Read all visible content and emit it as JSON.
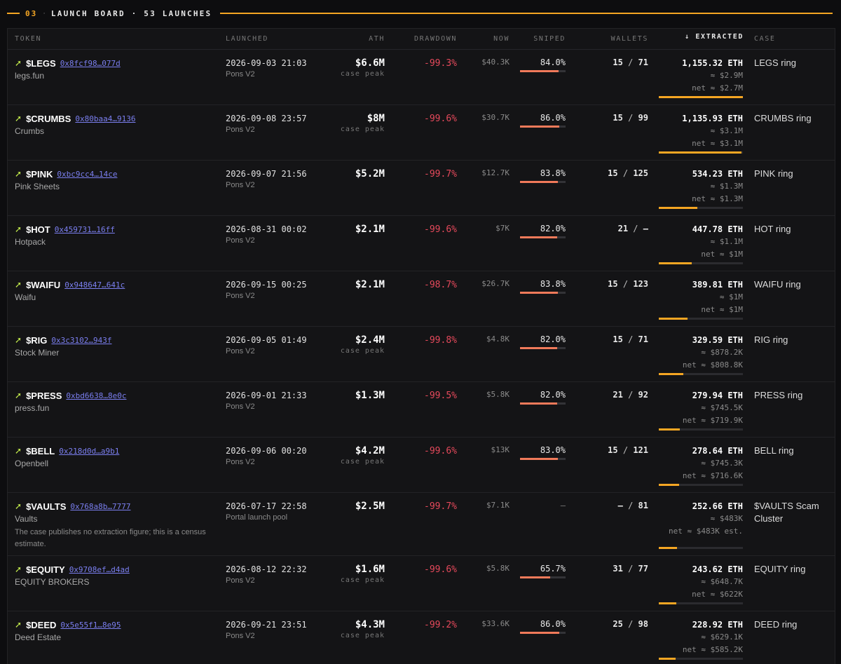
{
  "header": {
    "section_num": "03",
    "title": "LAUNCH BOARD · 53 LAUNCHES",
    "accent": "#f5a623"
  },
  "columns": {
    "token": "TOKEN",
    "launched": "LAUNCHED",
    "ath": "ATH",
    "drawdown": "DRAWDOWN",
    "now": "NOW",
    "sniped": "SNIPED",
    "wallets": "WALLETS",
    "extracted": "↓ EXTRACTED",
    "case": "CASE"
  },
  "rows": [
    {
      "symbol": "$LEGS",
      "addr": "0x8fcf98…077d",
      "name": "legs.fun",
      "launched": "2026-09-03 21:03",
      "platform": "Pons V2",
      "ath": "$6.6M",
      "ath_sub": "case peak",
      "drawdown": "-99.3%",
      "now": "$40.3K",
      "sniped": "84.0%",
      "sniped_frac": 0.84,
      "wallets_a": "15",
      "wallets_b": "71",
      "eth": "1,155.32 ETH",
      "usd": "≈ $2.9M",
      "net": "net ≈ $2.7M",
      "extract_frac": 1.0,
      "case": "LEGS ring"
    },
    {
      "symbol": "$CRUMBS",
      "addr": "0x80baa4…9136",
      "name": "Crumbs",
      "launched": "2026-09-08 23:57",
      "platform": "Pons V2",
      "ath": "$8M",
      "ath_sub": "case peak",
      "drawdown": "-99.6%",
      "now": "$30.7K",
      "sniped": "86.0%",
      "sniped_frac": 0.86,
      "wallets_a": "15",
      "wallets_b": "99",
      "eth": "1,135.93 ETH",
      "usd": "≈ $3.1M",
      "net": "net ≈ $3.1M",
      "extract_frac": 0.98,
      "case": "CRUMBS ring"
    },
    {
      "symbol": "$PINK",
      "addr": "0xbc9cc4…14ce",
      "name": "Pink Sheets",
      "launched": "2026-09-07 21:56",
      "platform": "Pons V2",
      "ath": "$5.2M",
      "ath_sub": "",
      "drawdown": "-99.7%",
      "now": "$12.7K",
      "sniped": "83.8%",
      "sniped_frac": 0.838,
      "wallets_a": "15",
      "wallets_b": "125",
      "eth": "534.23 ETH",
      "usd": "≈ $1.3M",
      "net": "net ≈ $1.3M",
      "extract_frac": 0.46,
      "case": "PINK ring"
    },
    {
      "symbol": "$HOT",
      "addr": "0x459731…16ff",
      "name": "Hotpack",
      "launched": "2026-08-31 00:02",
      "platform": "Pons V2",
      "ath": "$2.1M",
      "ath_sub": "",
      "drawdown": "-99.6%",
      "now": "$7K",
      "sniped": "82.0%",
      "sniped_frac": 0.82,
      "wallets_a": "21",
      "wallets_b": "—",
      "eth": "447.78 ETH",
      "usd": "≈ $1.1M",
      "net": "net ≈ $1M",
      "extract_frac": 0.39,
      "case": "HOT ring"
    },
    {
      "symbol": "$WAIFU",
      "addr": "0x948647…641c",
      "name": "Waifu",
      "launched": "2026-09-15 00:25",
      "platform": "Pons V2",
      "ath": "$2.1M",
      "ath_sub": "",
      "drawdown": "-98.7%",
      "now": "$26.7K",
      "sniped": "83.8%",
      "sniped_frac": 0.838,
      "wallets_a": "15",
      "wallets_b": "123",
      "eth": "389.81 ETH",
      "usd": "≈ $1M",
      "net": "net ≈ $1M",
      "extract_frac": 0.34,
      "case": "WAIFU ring"
    },
    {
      "symbol": "$RIG",
      "addr": "0x3c3102…943f",
      "name": "Stock Miner",
      "launched": "2026-09-05 01:49",
      "platform": "Pons V2",
      "ath": "$2.4M",
      "ath_sub": "case peak",
      "drawdown": "-99.8%",
      "now": "$4.8K",
      "sniped": "82.0%",
      "sniped_frac": 0.82,
      "wallets_a": "15",
      "wallets_b": "71",
      "eth": "329.59 ETH",
      "usd": "≈ $878.2K",
      "net": "net ≈ $808.8K",
      "extract_frac": 0.29,
      "case": "RIG ring"
    },
    {
      "symbol": "$PRESS",
      "addr": "0xbd6638…8e0c",
      "name": "press.fun",
      "launched": "2026-09-01 21:33",
      "platform": "Pons V2",
      "ath": "$1.3M",
      "ath_sub": "",
      "drawdown": "-99.5%",
      "now": "$5.8K",
      "sniped": "82.0%",
      "sniped_frac": 0.82,
      "wallets_a": "21",
      "wallets_b": "92",
      "eth": "279.94 ETH",
      "usd": "≈ $745.5K",
      "net": "net ≈ $719.9K",
      "extract_frac": 0.25,
      "case": "PRESS ring"
    },
    {
      "symbol": "$BELL",
      "addr": "0x218d0d…a9b1",
      "name": "Openbell",
      "launched": "2026-09-06 00:20",
      "platform": "Pons V2",
      "ath": "$4.2M",
      "ath_sub": "case peak",
      "drawdown": "-99.6%",
      "now": "$13K",
      "sniped": "83.0%",
      "sniped_frac": 0.83,
      "wallets_a": "15",
      "wallets_b": "121",
      "eth": "278.64 ETH",
      "usd": "≈ $745.3K",
      "net": "net ≈ $716.6K",
      "extract_frac": 0.24,
      "case": "BELL ring"
    },
    {
      "symbol": "$VAULTS",
      "addr": "0x768a8b…7777",
      "name": "Vaults",
      "note": "The case publishes no extraction figure; this is a census estimate.",
      "launched": "2026-07-17 22:58",
      "platform": "Portal launch pool",
      "ath": "$2.5M",
      "ath_sub": "",
      "drawdown": "-99.7%",
      "now": "$7.1K",
      "sniped": "—",
      "sniped_frac": null,
      "wallets_a": "—",
      "wallets_b": "81",
      "eth": "252.66 ETH",
      "usd": "≈ $483K",
      "net": "net ≈ $483K est.",
      "extract_frac": 0.22,
      "case": "$VAULTS Scam Cluster"
    },
    {
      "symbol": "$EQUITY",
      "addr": "0x9708ef…d4ad",
      "name": "EQUITY BROKERS",
      "launched": "2026-08-12 22:32",
      "platform": "Pons V2",
      "ath": "$1.6M",
      "ath_sub": "case peak",
      "drawdown": "-99.6%",
      "now": "$5.8K",
      "sniped": "65.7%",
      "sniped_frac": 0.657,
      "wallets_a": "31",
      "wallets_b": "77",
      "eth": "243.62 ETH",
      "usd": "≈ $648.7K",
      "net": "net ≈ $622K",
      "extract_frac": 0.21,
      "case": "EQUITY ring"
    },
    {
      "symbol": "$DEED",
      "addr": "0x5e55f1…8e95",
      "name": "Deed Estate",
      "launched": "2026-09-21 23:51",
      "platform": "Pons V2",
      "ath": "$4.3M",
      "ath_sub": "case peak",
      "drawdown": "-99.2%",
      "now": "$33.6K",
      "sniped": "86.0%",
      "sniped_frac": 0.86,
      "wallets_a": "25",
      "wallets_b": "98",
      "eth": "228.92 ETH",
      "usd": "≈ $629.1K",
      "net": "net ≈ $585.2K",
      "extract_frac": 0.2,
      "case": "DEED ring"
    }
  ]
}
